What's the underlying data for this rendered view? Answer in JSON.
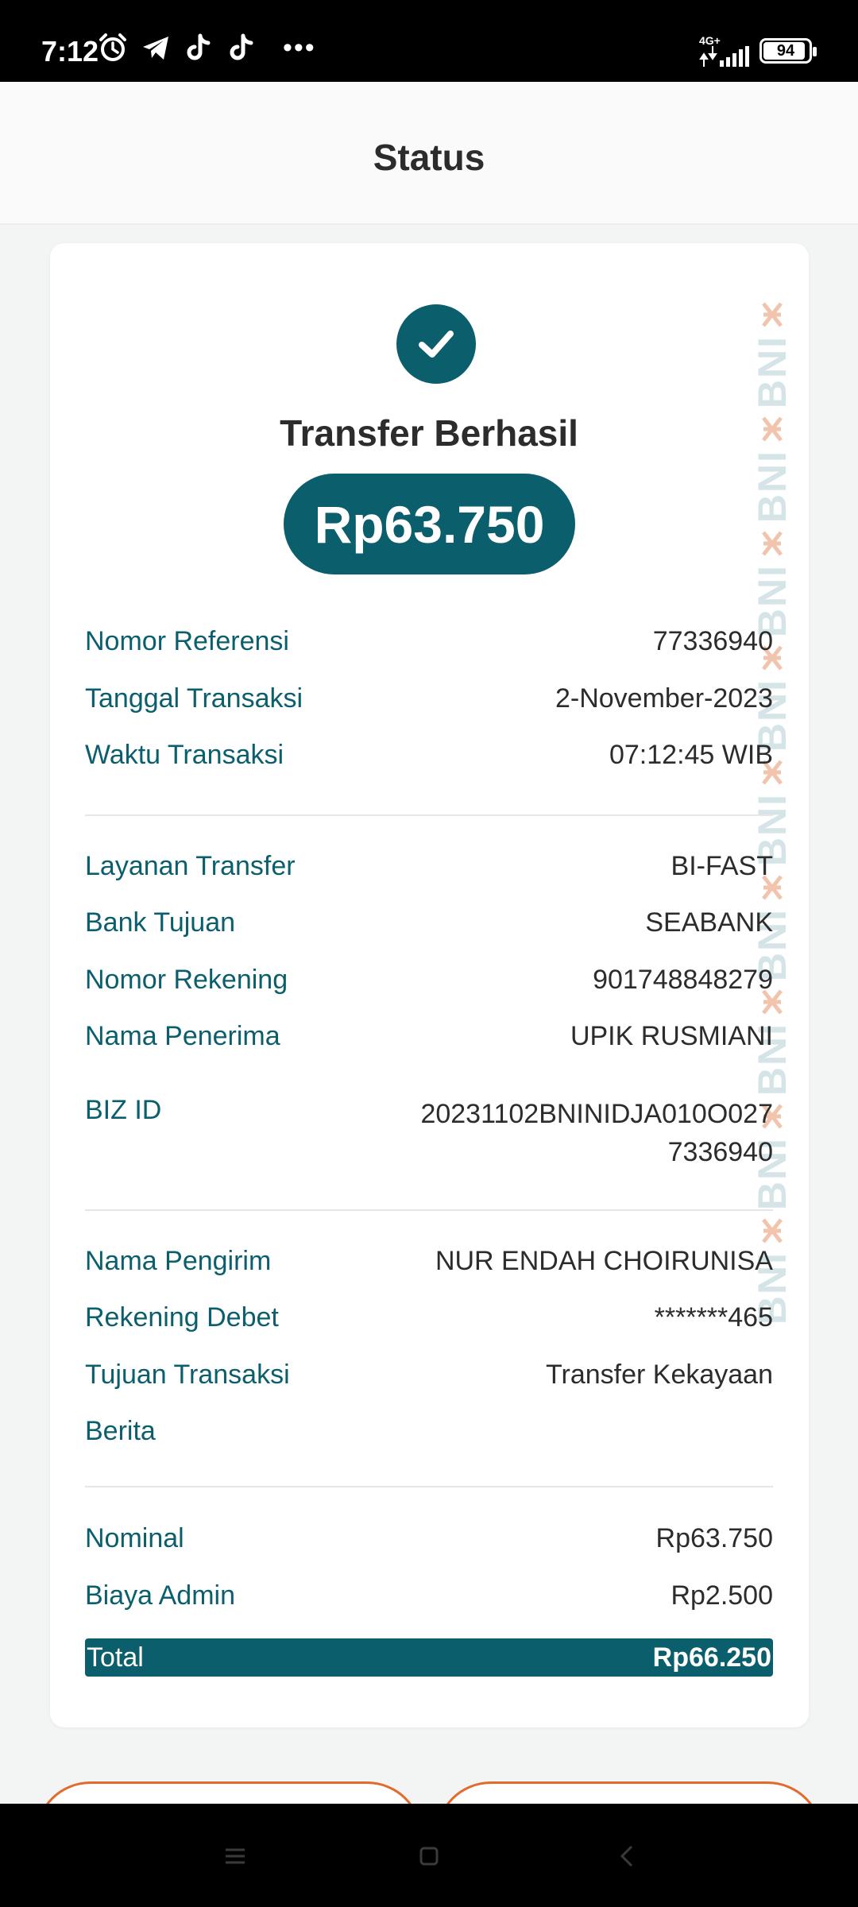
{
  "status_bar": {
    "time": "7:12",
    "network": "4G+",
    "battery": "94",
    "battery_fraction": 0.94,
    "icons": [
      "alarm-icon",
      "telegram-icon",
      "tiktok-icon",
      "tiktok-icon",
      "more-dots-icon",
      "signal-icon"
    ]
  },
  "header": {
    "title": "Status"
  },
  "receipt": {
    "success_title": "Transfer Berhasil",
    "amount": "Rp63.750",
    "transaction": [
      {
        "label": "Nomor Referensi",
        "value": "77336940"
      },
      {
        "label": "Tanggal Transaksi",
        "value": "2-November-2023"
      },
      {
        "label": "Waktu Transaksi",
        "value": "07:12:45 WIB"
      }
    ],
    "transfer": [
      {
        "label": "Layanan Transfer",
        "value": "BI-FAST"
      },
      {
        "label": "Bank Tujuan",
        "value": "SEABANK"
      },
      {
        "label": "Nomor Rekening",
        "value": "901748848279"
      },
      {
        "label": "Nama Penerima",
        "value": "UPIK RUSMIANI"
      }
    ],
    "biz": {
      "label": "BIZ ID",
      "value_line1": "20231102BNINIDJA010O027",
      "value_line2": "7336940"
    },
    "sender": [
      {
        "label": "Nama Pengirim",
        "value": "NUR ENDAH CHOIRUNISA"
      },
      {
        "label": "Rekening Debet",
        "value": "*******465"
      },
      {
        "label": "Tujuan Transaksi",
        "value": "Transfer Kekayaan"
      },
      {
        "label": "Berita",
        "value": ""
      }
    ],
    "summary": [
      {
        "label": "Nominal",
        "value": "Rp63.750"
      },
      {
        "label": "Biaya Admin",
        "value": "Rp2.500"
      }
    ],
    "total": {
      "label": "Total",
      "value": "Rp66.250"
    }
  },
  "watermark": {
    "text": "BNI"
  },
  "colors": {
    "brand_teal": "#0b5f6d",
    "accent_orange": "#e36a2d",
    "text_dark": "#2c2c2c"
  }
}
